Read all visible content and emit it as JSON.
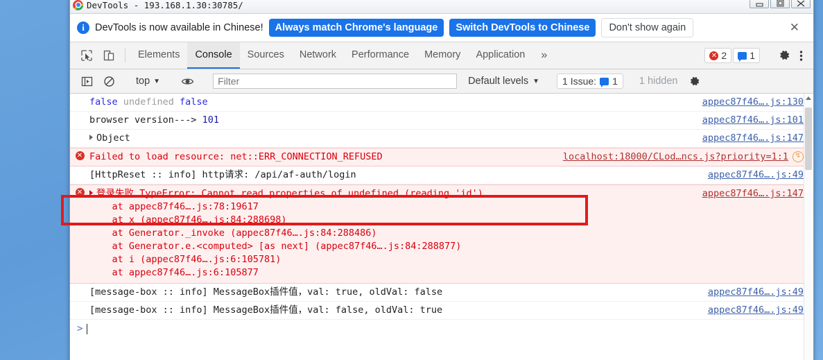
{
  "window": {
    "title": "DevTools - 193.168.1.30:30785/",
    "controls": {
      "minimize": "—",
      "maximize": "❐",
      "close": "✕"
    }
  },
  "banner": {
    "icon": "info-icon",
    "message": "DevTools is now available in Chinese!",
    "primary_button": "Always match Chrome's language",
    "secondary_button": "Switch DevTools to Chinese",
    "tertiary_button": "Don't show again",
    "close": "✕"
  },
  "tabbar": {
    "inspect_icon": "inspect-cursor-icon",
    "device_icon": "device-toolbar-icon",
    "tabs": [
      {
        "label": "Elements",
        "active": false
      },
      {
        "label": "Console",
        "active": true
      },
      {
        "label": "Sources",
        "active": false
      },
      {
        "label": "Network",
        "active": false
      },
      {
        "label": "Performance",
        "active": false
      },
      {
        "label": "Memory",
        "active": false
      },
      {
        "label": "Application",
        "active": false
      }
    ],
    "more_tabs": "»",
    "error_count": "2",
    "message_count": "1",
    "settings_icon": "gear-icon",
    "more_icon": "kebab-menu-icon"
  },
  "console_toolbar": {
    "sidebar_icon": "show-console-sidebar-icon",
    "clear_icon": "clear-console-icon",
    "context": "top",
    "context_caret": "▼",
    "eye_icon": "live-expression-icon",
    "filter_placeholder": "Filter",
    "filter_value": "",
    "levels": "Default levels",
    "levels_caret": "▼",
    "issues_label": "1 Issue:",
    "issues_count": "1",
    "hidden_label": "1 hidden",
    "settings_icon": "gear-icon"
  },
  "console_rows": [
    {
      "type": "log",
      "parts": [
        {
          "text": "false",
          "style": "kw"
        },
        {
          "text": " undefined ",
          "style": "undef"
        },
        {
          "text": "false",
          "style": "kw"
        }
      ],
      "source": "appec87f46….js:130"
    },
    {
      "type": "log",
      "parts": [
        {
          "text": "browser version---> ",
          "style": "plain"
        },
        {
          "text": "101",
          "style": "num"
        }
      ],
      "source": "appec87f46….js:101"
    },
    {
      "type": "object",
      "expander": "▶",
      "parts": [
        {
          "text": "Object",
          "style": "plain"
        }
      ],
      "source": "appec87f46….js:147"
    },
    {
      "type": "error",
      "icon": "error-icon",
      "parts": [
        {
          "text": "Failed to load resource: net::ERR_CONNECTION_REFUSED",
          "style": "plain"
        }
      ],
      "source": "localhost:18000/CLod…ncs.js?priority=1:1",
      "badge": "issue-warning-icon"
    },
    {
      "type": "log",
      "parts": [
        {
          "text": "[HttpReset :: info] http请求: /api/af-auth/login",
          "style": "plain"
        }
      ],
      "source": "appec87f46….js:49"
    }
  ],
  "error_block": {
    "icon": "error-icon",
    "expander": "▶",
    "headline": "登录失败 TypeError: Cannot read properties of undefined (reading 'id')",
    "source": "appec87f46….js:147",
    "stack": [
      "    at appec87f46….js:78:19617",
      "    at x (appec87f46….js:84:288698)",
      "    at Generator._invoke (appec87f46….js:84:288486)",
      "    at Generator.e.<computed> [as next] (appec87f46….js:84:288877)",
      "    at i (appec87f46….js:6:105781)",
      "    at appec87f46….js:6:105877"
    ]
  },
  "trailing_rows": [
    {
      "type": "log",
      "text": "[message-box :: info] MessageBox插件值，val: true, oldVal: false",
      "source": "appec87f46….js:49"
    },
    {
      "type": "log",
      "text": "[message-box :: info] MessageBox插件值，val: false, oldVal: true",
      "source": "appec87f46….js:49"
    }
  ],
  "prompt": {
    "arrow": ">",
    "value": ""
  },
  "annotation": {
    "color": "#e01b1b",
    "shape": "rectangle"
  },
  "colors": {
    "accent_blue": "#1a73e8",
    "error_red": "#d93025",
    "error_text": "#d8000c",
    "link_blue": "#3c5fa8",
    "annotation_red": "#e01b1b",
    "desktop_blue": "#5b9bd5"
  }
}
